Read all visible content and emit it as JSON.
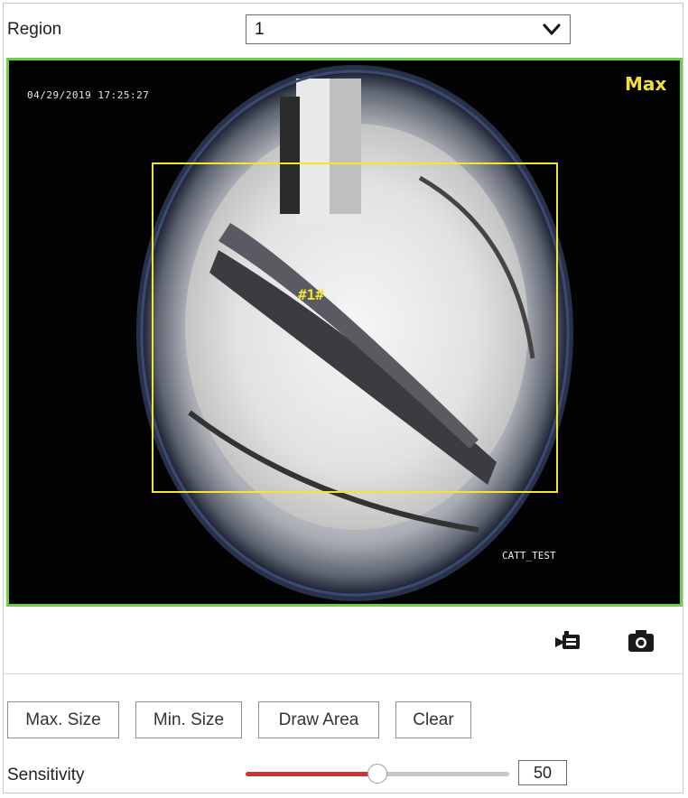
{
  "region": {
    "label": "Region",
    "selected": "1"
  },
  "video": {
    "timestamp": "04/29/2019 17:25:27",
    "mode_label": "Max",
    "target_label": "#1#",
    "camera_name": "CATT_TEST"
  },
  "buttons": {
    "max_size": "Max. Size",
    "min_size": "Min. Size",
    "draw_area": "Draw Area",
    "clear": "Clear"
  },
  "sensitivity": {
    "label": "Sensitivity",
    "value": "50",
    "fraction": 0.5
  },
  "icons": {
    "record": "video-record-icon",
    "capture": "camera-capture-icon"
  },
  "colors": {
    "accent": "#d0323b",
    "video_border": "#6fce3f",
    "overlay": "#f2e62e"
  }
}
